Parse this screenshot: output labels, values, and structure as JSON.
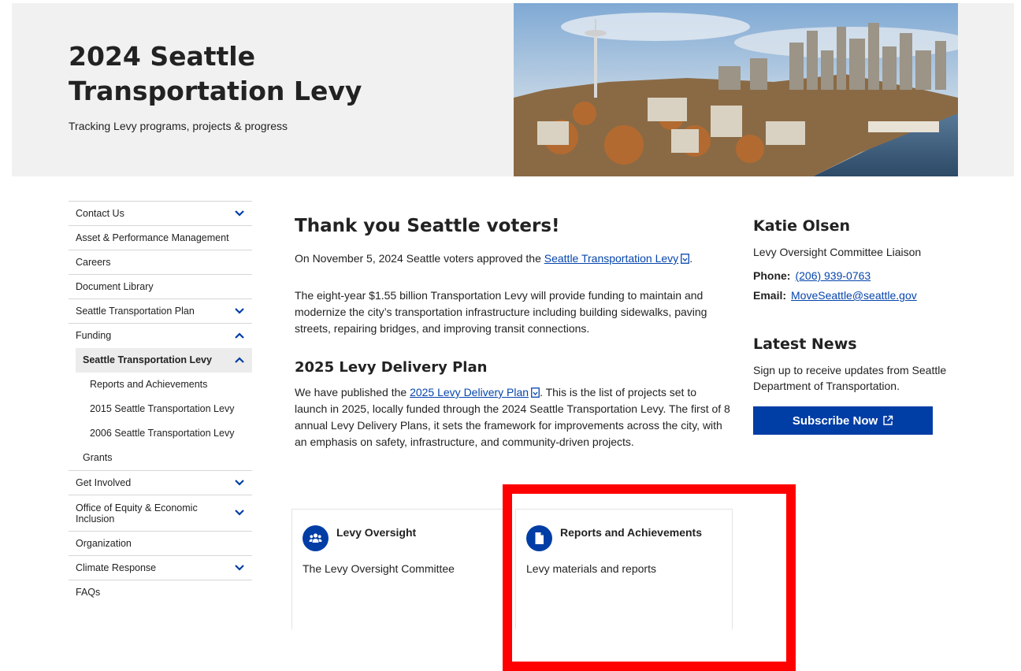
{
  "hero": {
    "title": "2024 Seattle Transportation Levy",
    "subtitle": "Tracking Levy programs, projects & progress"
  },
  "sidebar": {
    "items": [
      {
        "label": "Contact Us",
        "expandable": true
      },
      {
        "label": "Asset & Performance Management"
      },
      {
        "label": "Careers"
      },
      {
        "label": "Document Library"
      },
      {
        "label": "Seattle Transportation Plan",
        "expandable": true
      },
      {
        "label": "Funding",
        "expanded": true
      }
    ],
    "funding_children": {
      "active": "Seattle Transportation Levy",
      "levy_children": [
        "Reports and Achievements",
        "2015 Seattle Transportation Levy",
        "2006 Seattle Transportation Levy"
      ],
      "grants": "Grants"
    },
    "items_after": [
      {
        "label": "Get Involved",
        "expandable": true
      },
      {
        "label": "Office of Equity & Economic Inclusion",
        "expandable": true
      },
      {
        "label": "Organization"
      },
      {
        "label": "Climate Response",
        "expandable": true
      },
      {
        "label": "FAQs"
      }
    ]
  },
  "main": {
    "heading": "Thank you Seattle voters!",
    "intro_prefix": "On November 5, 2024 Seattle voters approved the ",
    "intro_link": "Seattle Transportation Levy",
    "intro_suffix": ".",
    "paragraph2": "The eight-year $1.55 billion Transportation Levy will provide funding to maintain and modernize the city’s transportation infrastructure including building sidewalks, paving streets, repairing bridges, and improving transit connections.",
    "delivery_heading": "2025 Levy Delivery Plan",
    "delivery_prefix": "We have published the ",
    "delivery_link": "2025 Levy Delivery Plan",
    "delivery_suffix": ". This is the list of projects set to launch in 2025, locally funded through the 2024 Seattle Transportation Levy. The first of 8 annual Levy Delivery Plans, it sets the framework for improvements across the city, with an emphasis on safety, infrastructure, and community-driven projects."
  },
  "cards": [
    {
      "title": "Levy Oversight",
      "description": "The Levy Oversight Committee",
      "icon": "people-icon"
    },
    {
      "title": "Reports and Achievements",
      "description": "Levy materials and reports",
      "icon": "document-icon"
    }
  ],
  "contact": {
    "name": "Katie Olsen",
    "role": "Levy Oversight Committee Liaison",
    "phone_label": "Phone:",
    "phone": "(206) 939-0763",
    "email_label": "Email:",
    "email": "MoveSeattle@seattle.gov"
  },
  "news": {
    "heading": "Latest News",
    "text": "Sign up to receive updates from Seattle Department of Transportation.",
    "button": "Subscribe Now"
  },
  "colors": {
    "brand_blue": "#003da5",
    "highlight": "#ff0000",
    "hero_bg": "#f1f1f1"
  }
}
